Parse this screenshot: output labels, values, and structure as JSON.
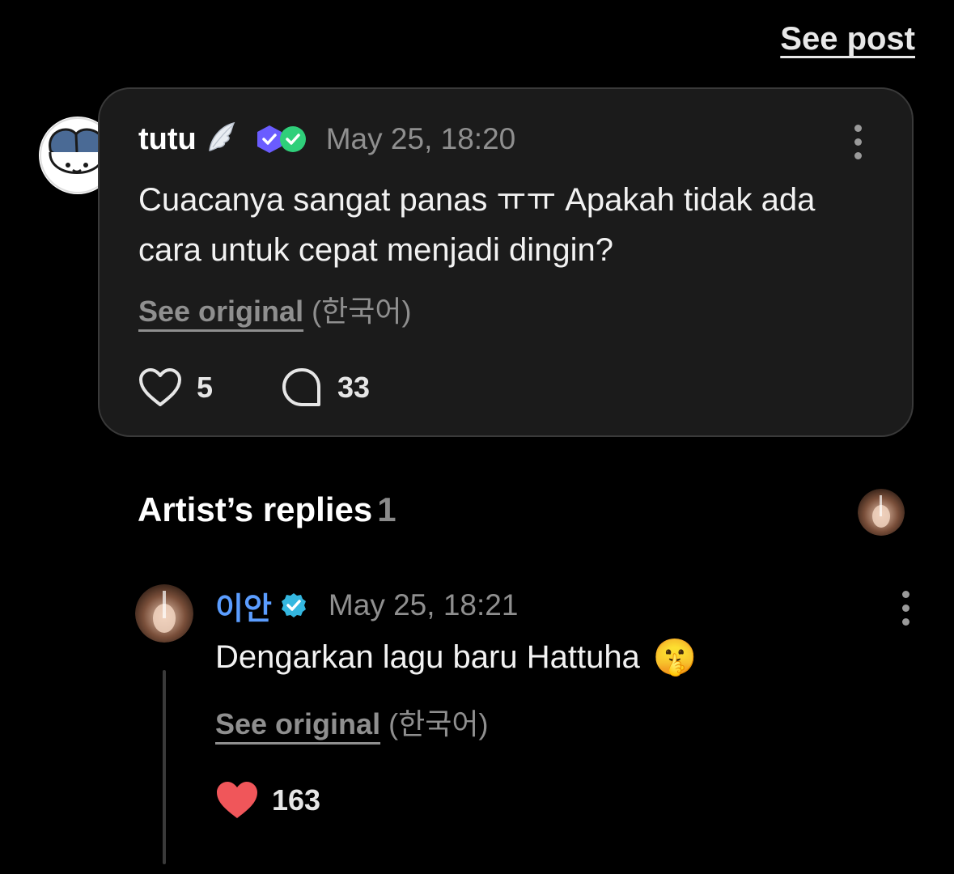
{
  "header": {
    "see_post_label": "See post"
  },
  "post": {
    "username": "tutu",
    "timestamp": "May 25, 18:20",
    "text": "Cuacanya sangat panas ㅠㅠ Apakah tidak ada cara untuk cepat menjadi dingin?",
    "see_original_label": "See original",
    "original_language": "(한국어)",
    "like_count": "5",
    "comment_count": "33"
  },
  "artist_replies": {
    "title": "Artist’s replies",
    "count": "1"
  },
  "reply": {
    "username": "이안",
    "timestamp": "May 25, 18:21",
    "text": "Dengarkan lagu baru Hattuha",
    "emoji": "🤫",
    "see_original_label": "See original",
    "original_language": "(한국어)",
    "like_count": "163"
  },
  "colors": {
    "background": "#000000",
    "card": "#1b1b1b",
    "artist_name": "#5b9dff",
    "liked_heart": "#f0565a",
    "muted": "#8f8f8f"
  }
}
